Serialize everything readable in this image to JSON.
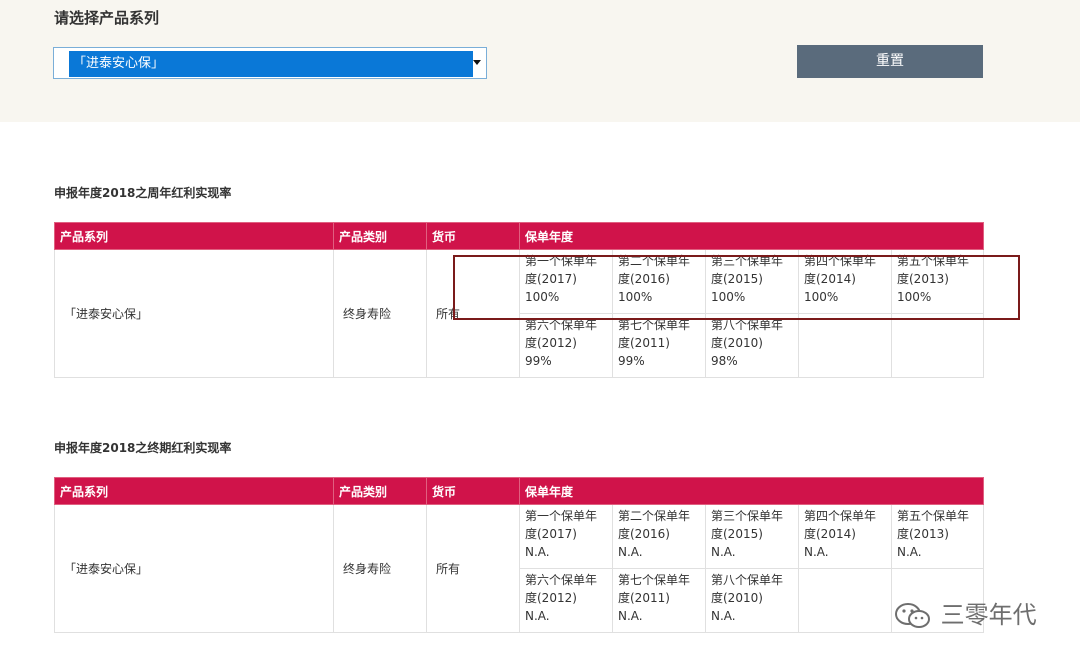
{
  "selector": {
    "label": "请选择产品系列",
    "selected": "「进泰安心保」"
  },
  "reset_label": "重置",
  "tables": [
    {
      "title": "申报年度2018之周年红利实现率",
      "headers": [
        "产品系列",
        "产品类别",
        "货币",
        "保单年度"
      ],
      "product": "「进泰安心保」",
      "category": "终身寿险",
      "currency": "所有",
      "years": [
        {
          "label_line1": "第一个保单年",
          "label_line2": "度(2017)",
          "value": "100%"
        },
        {
          "label_line1": "第二个保单年",
          "label_line2": "度(2016)",
          "value": "100%"
        },
        {
          "label_line1": "第三个保单年",
          "label_line2": "度(2015)",
          "value": "100%"
        },
        {
          "label_line1": "第四个保单年",
          "label_line2": "度(2014)",
          "value": "100%"
        },
        {
          "label_line1": "第五个保单年",
          "label_line2": "度(2013)",
          "value": "100%"
        },
        {
          "label_line1": "第六个保单年",
          "label_line2": "度(2012)",
          "value": "99%"
        },
        {
          "label_line1": "第七个保单年",
          "label_line2": "度(2011)",
          "value": "99%"
        },
        {
          "label_line1": "第八个保单年",
          "label_line2": "度(2010)",
          "value": "98%"
        }
      ]
    },
    {
      "title": "申报年度2018之终期红利实现率",
      "headers": [
        "产品系列",
        "产品类别",
        "货币",
        "保单年度"
      ],
      "product": "「进泰安心保」",
      "category": "终身寿险",
      "currency": "所有",
      "years": [
        {
          "label_line1": "第一个保单年",
          "label_line2": "度(2017)",
          "value": "N.A."
        },
        {
          "label_line1": "第二个保单年",
          "label_line2": "度(2016)",
          "value": "N.A."
        },
        {
          "label_line1": "第三个保单年",
          "label_line2": "度(2015)",
          "value": "N.A."
        },
        {
          "label_line1": "第四个保单年",
          "label_line2": "度(2014)",
          "value": "N.A."
        },
        {
          "label_line1": "第五个保单年",
          "label_line2": "度(2013)",
          "value": "N.A."
        },
        {
          "label_line1": "第六个保单年",
          "label_line2": "度(2012)",
          "value": "N.A."
        },
        {
          "label_line1": "第七个保单年",
          "label_line2": "度(2011)",
          "value": "N.A."
        },
        {
          "label_line1": "第八个保单年",
          "label_line2": "度(2010)",
          "value": "N.A."
        }
      ]
    }
  ],
  "watermark": "三零年代",
  "colors": {
    "header_bg": "#d0134a",
    "select_bg": "#0a78d7",
    "button_bg": "#5a6b7c",
    "highlight_border": "#7a1a1a"
  }
}
